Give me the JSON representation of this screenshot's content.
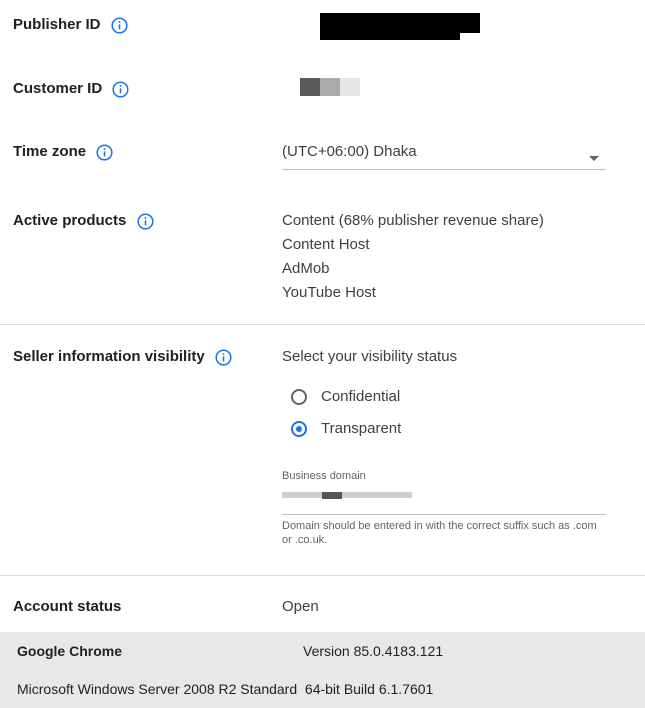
{
  "publisher": {
    "label": "Publisher ID"
  },
  "customer": {
    "label": "Customer ID"
  },
  "timezone": {
    "label": "Time zone",
    "value": "(UTC+06:00) Dhaka"
  },
  "products": {
    "label": "Active products",
    "items": [
      "Content (68% publisher revenue share)",
      "Content Host",
      "AdMob",
      "YouTube Host"
    ]
  },
  "seller": {
    "label": "Seller information visibility",
    "prompt": "Select your visibility status",
    "options": [
      {
        "label": "Confidential",
        "selected": false
      },
      {
        "label": "Transparent",
        "selected": true
      }
    ],
    "domain_label": "Business domain",
    "domain_help": "Domain should be entered in with the correct suffix such as .com or .co.uk."
  },
  "account": {
    "label": "Account status",
    "value": "Open"
  },
  "footer": {
    "browser": "Google Chrome",
    "version": "Version 85.0.4183.121",
    "os": "Microsoft Windows Server 2008 R2 Standard  64-bit Build 6.1.7601"
  },
  "colors": {
    "accent": "#1a73e8",
    "icon": "#1a73e8",
    "footer_bg": "#e8e8e8"
  },
  "icons": {
    "info": "info-circle-icon",
    "dropdown": "caret-down-icon"
  }
}
